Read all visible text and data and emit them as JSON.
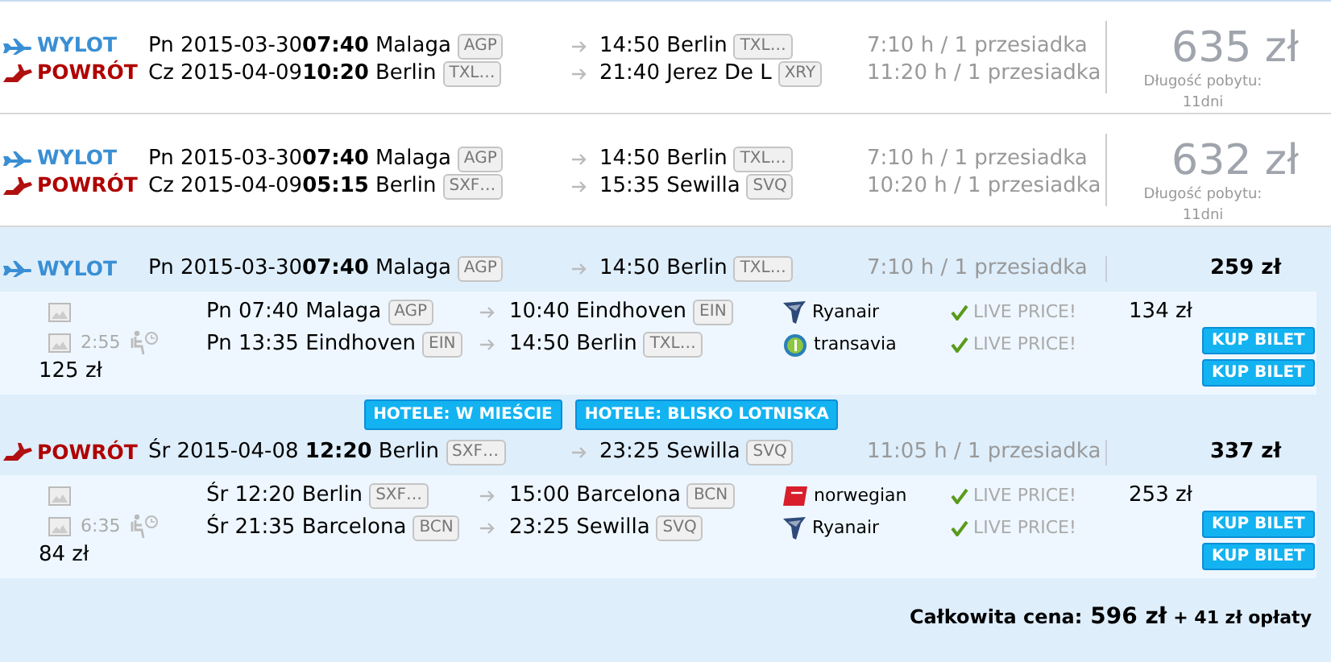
{
  "results": [
    {
      "legs": [
        {
          "kind": "outbound",
          "label": "WYLOT",
          "departure": "Pn 2015-03-30**07:40**",
          "from": "Malaga",
          "from_code": "AGP",
          "arrival": "14:50 Berlin",
          "to_code": "TXL…",
          "duration": "7:10 h / 1 przesiadka"
        },
        {
          "kind": "return",
          "label": "POWRÓT",
          "departure": "Cz 2015-04-09**10:20**",
          "from": "Berlin",
          "from_code": "TXL…",
          "arrival": "21:40 Jerez De L",
          "to_code": "XRY",
          "duration": "11:20 h / 1 przesiadka"
        }
      ],
      "price": "635 zł",
      "stay_label": "Długość pobytu:",
      "stay_value": "11dni"
    },
    {
      "legs": [
        {
          "kind": "outbound",
          "label": "WYLOT",
          "departure": "Pn 2015-03-30**07:40**",
          "from": "Malaga",
          "from_code": "AGP",
          "arrival": "14:50 Berlin",
          "to_code": "TXL…",
          "duration": "7:10 h / 1 przesiadka"
        },
        {
          "kind": "return",
          "label": "POWRÓT",
          "departure": "Cz 2015-04-09**05:15**",
          "from": "Berlin",
          "from_code": "SXF…",
          "arrival": "15:35 Sewilla",
          "to_code": "SVQ",
          "duration": "10:20 h / 1 przesiadka"
        }
      ],
      "price": "632 zł",
      "stay_label": "Długość pobytu:",
      "stay_value": "11dni"
    }
  ],
  "selected_trip": {
    "sections": [
      {
        "leg": {
          "kind": "outbound",
          "label": "WYLOT",
          "departure": "Pn 2015-03-30**07:40**",
          "from": "Malaga",
          "from_code": "AGP",
          "arrival": "14:50 Berlin",
          "to_code": "TXL…",
          "duration": "7:10 h / 1 przesiadka"
        },
        "price": "259 zł",
        "layover": "2:55",
        "subtotal": "125 zł",
        "segments": [
          {
            "departure": "Pn 07:40 Malaga",
            "from_code": "AGP",
            "arrival": "10:40 Eindhoven",
            "to_code": "EIN",
            "kind": "ryanair",
            "carrier": "Ryanair",
            "live": "LIVE PRICE!",
            "price": "134 zł",
            "buy_button": "KUP BILET"
          },
          {
            "departure": "Pn 13:35 Eindhoven",
            "from_code": "EIN",
            "arrival": "14:50 Berlin",
            "to_code": "TXL…",
            "kind": "transavia",
            "carrier": "transavia",
            "live": "LIVE PRICE!",
            "buy_button": "KUP BILET"
          }
        ],
        "hotel_buttons": [
          "HOTELE: W MIEŚCIE",
          "HOTELE: BLISKO LOTNISKA"
        ]
      },
      {
        "leg": {
          "kind": "return",
          "label": "POWRÓT",
          "departure": "Śr 2015-04-08 **12:20**",
          "from": "Berlin",
          "from_code": "SXF…",
          "arrival": "23:25 Sewilla",
          "to_code": "SVQ",
          "duration": "11:05 h / 1 przesiadka"
        },
        "price": "337 zł",
        "layover": "6:35",
        "subtotal": "84 zł",
        "segments": [
          {
            "departure": "Śr 12:20 Berlin",
            "from_code": "SXF…",
            "arrival": "15:00 Barcelona",
            "to_code": "BCN",
            "kind": "norwegian",
            "carrier": "norwegian",
            "live": "LIVE PRICE!",
            "price": "253 zł",
            "buy_button": "KUP BILET"
          },
          {
            "departure": "Śr 21:35 Barcelona",
            "from_code": "BCN",
            "arrival": "23:25 Sewilla",
            "to_code": "SVQ",
            "kind": "ryanair",
            "carrier": "Ryanair",
            "live": "LIVE PRICE!",
            "buy_button": "KUP BILET"
          }
        ]
      }
    ],
    "total": {
      "label": "Całkowita cena:",
      "amount": "596 zł",
      "fees": "+ 41 zł opłaty"
    }
  }
}
